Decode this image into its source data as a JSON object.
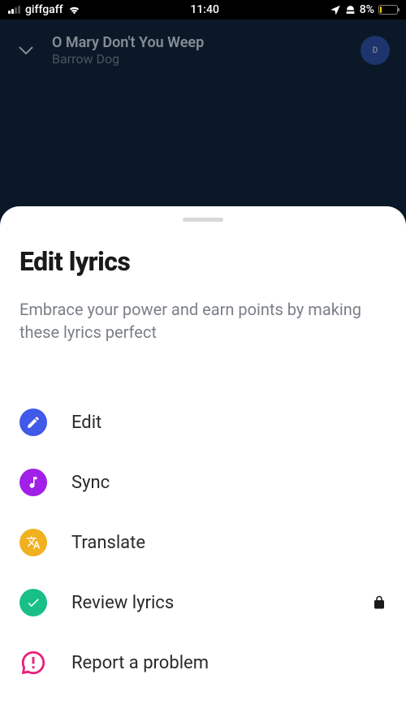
{
  "statusBar": {
    "carrier": "giffgaff",
    "time": "11:40",
    "battery": "8%"
  },
  "player": {
    "trackTitle": "O Mary Don't You Weep",
    "trackArtist": "Barrow Dog",
    "avatarInitial": "D"
  },
  "sheet": {
    "title": "Edit lyrics",
    "subtitle": "Embrace your power and earn points by making these lyrics perfect",
    "menu": {
      "edit": "Edit",
      "sync": "Sync",
      "translate": "Translate",
      "review": "Review lyrics",
      "report": "Report a problem"
    }
  }
}
